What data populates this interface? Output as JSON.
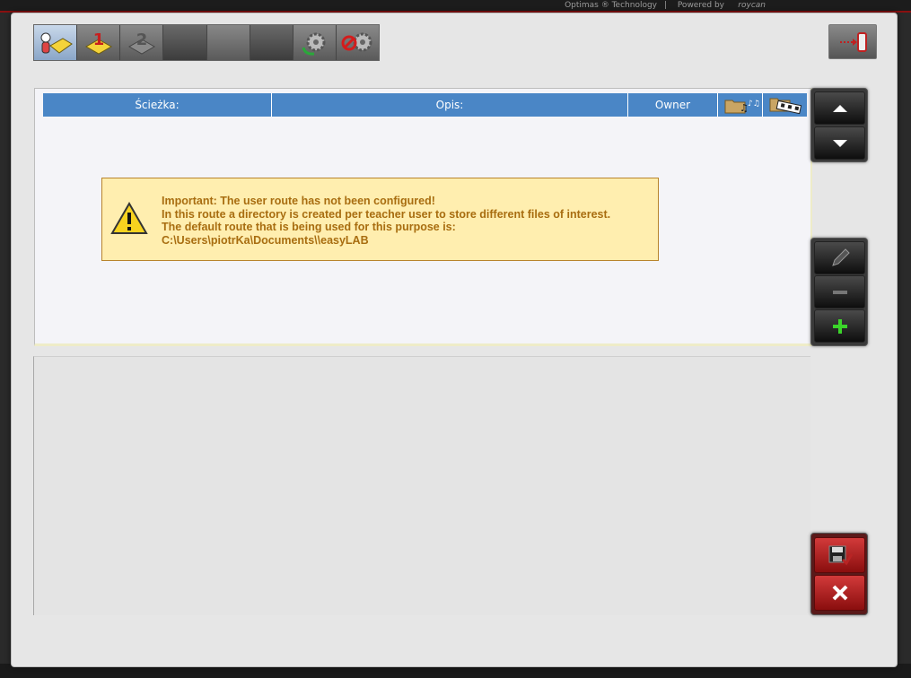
{
  "topbar": {
    "brand": "Optimas ® Technology",
    "separator": "|",
    "powered": "Powered by",
    "powered_brand": "roycan"
  },
  "colors": {
    "header_blue": "#4a86c6",
    "warning_bg": "#ffeeaf",
    "warning_text": "#a86d10",
    "accent_red": "#c02020"
  },
  "toolbar": {
    "buttons": [
      {
        "icon": "user-folder-icon",
        "active": true
      },
      {
        "icon": "step-1-icon",
        "label": "1"
      },
      {
        "icon": "step-2-icon",
        "label": "2"
      },
      {
        "icon": "blank"
      },
      {
        "icon": "blank"
      },
      {
        "icon": "blank"
      },
      {
        "icon": "gear-refresh-icon"
      },
      {
        "icon": "gear-disabled-icon"
      }
    ],
    "exit_icon": "exit-device-icon"
  },
  "table": {
    "columns": [
      {
        "label": "Ścieżka:"
      },
      {
        "label": "Opis:"
      },
      {
        "label": "Owner"
      },
      {
        "label": "",
        "icon": "folder-music-icon"
      },
      {
        "label": "",
        "icon": "folder-film-icon"
      }
    ],
    "rows": []
  },
  "warning": {
    "icon": "warning-triangle-icon",
    "line1": "Important: The user route has not been configured!",
    "line2": "In this route a directory is created per teacher user to store different files of interest.",
    "line3": "The default route that is being used for this purpose is:",
    "line4": "C:\\Users\\piotrKa\\Documents\\\\easyLAB"
  },
  "side_buttons": {
    "nav": [
      "arrow-up-icon",
      "arrow-down-icon"
    ],
    "edit": [
      "pencil-icon",
      "minus-icon",
      "plus-icon"
    ],
    "actions": [
      "save-icon",
      "close-icon"
    ]
  }
}
